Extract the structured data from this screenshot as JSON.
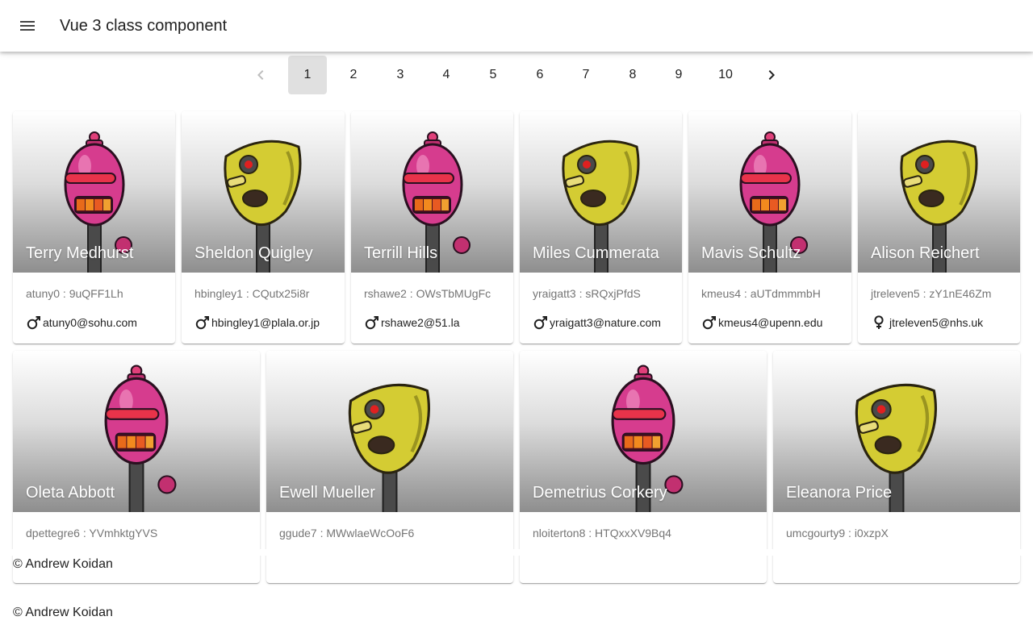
{
  "app": {
    "title": "Vue 3 class component",
    "menu_icon": "menu-icon"
  },
  "pagination": {
    "prev_icon": "chevron-left-icon",
    "next_icon": "chevron-right-icon",
    "current": 1,
    "pages": [
      "1",
      "2",
      "3",
      "4",
      "5",
      "6",
      "7",
      "8",
      "9",
      "10"
    ]
  },
  "users": [
    {
      "name": "Terry Medhurst",
      "username": "atuny0",
      "password": "9uQFF1Lh",
      "credentials": "atuny0 : 9uQFF1Lh",
      "email": "atuny0@sohu.com",
      "gender": "male",
      "avatar": "pink-robot"
    },
    {
      "name": "Sheldon Quigley",
      "username": "hbingley1",
      "password": "CQutx25i8r",
      "credentials": "hbingley1 : CQutx25i8r",
      "email": "hbingley1@plala.or.jp",
      "gender": "male",
      "avatar": "yellow-robot"
    },
    {
      "name": "Terrill Hills",
      "username": "rshawe2",
      "password": "OWsTbMUgFc",
      "credentials": "rshawe2 : OWsTbMUgFc",
      "email": "rshawe2@51.la",
      "gender": "male",
      "avatar": "pink-robot"
    },
    {
      "name": "Miles Cummerata",
      "username": "yraigatt3",
      "password": "sRQxjPfdS",
      "credentials": "yraigatt3 : sRQxjPfdS",
      "email": "yraigatt3@nature.com",
      "gender": "male",
      "avatar": "yellow-robot"
    },
    {
      "name": "Mavis Schultz",
      "username": "kmeus4",
      "password": "aUTdmmmbH",
      "credentials": "kmeus4 : aUTdmmmbH",
      "email": "kmeus4@upenn.edu",
      "gender": "male",
      "avatar": "pink-robot"
    },
    {
      "name": "Alison Reichert",
      "username": "jtreleven5",
      "password": "zY1nE46Zm",
      "credentials": "jtreleven5 : zY1nE46Zm",
      "email": "jtreleven5@nhs.uk",
      "gender": "female",
      "avatar": "yellow-robot"
    },
    {
      "name": "Oleta Abbott",
      "username": "dpettegre6",
      "password": "YVmhktgYVS",
      "credentials": "dpettegre6 : YVmhktgYVS",
      "email": "",
      "gender": "",
      "avatar": "pink-robot"
    },
    {
      "name": "Ewell Mueller",
      "username": "ggude7",
      "password": "MWwlaeWcOoF6",
      "credentials": "ggude7 : MWwlaeWcOoF6",
      "email": "",
      "gender": "",
      "avatar": "yellow-robot"
    },
    {
      "name": "Demetrius Corkery",
      "username": "nloiterton8",
      "password": "HTQxxXV9Bq4",
      "credentials": "nloiterton8 : HTQxxXV9Bq4",
      "email": "",
      "gender": "",
      "avatar": "pink-robot"
    },
    {
      "name": "Eleanora Price",
      "username": "umcgourty9",
      "password": "i0xzpX",
      "credentials": "umcgourty9 : i0xzpX",
      "email": "",
      "gender": "",
      "avatar": "yellow-robot"
    }
  ],
  "footer": {
    "inline_text": "© Andrew Koidan",
    "bottom_text": "© Andrew Koidan"
  },
  "colors": {
    "active_page_bg": "#e0e0e0",
    "pink_robot": "#d63c8e",
    "yellow_robot": "#d4cc33"
  }
}
